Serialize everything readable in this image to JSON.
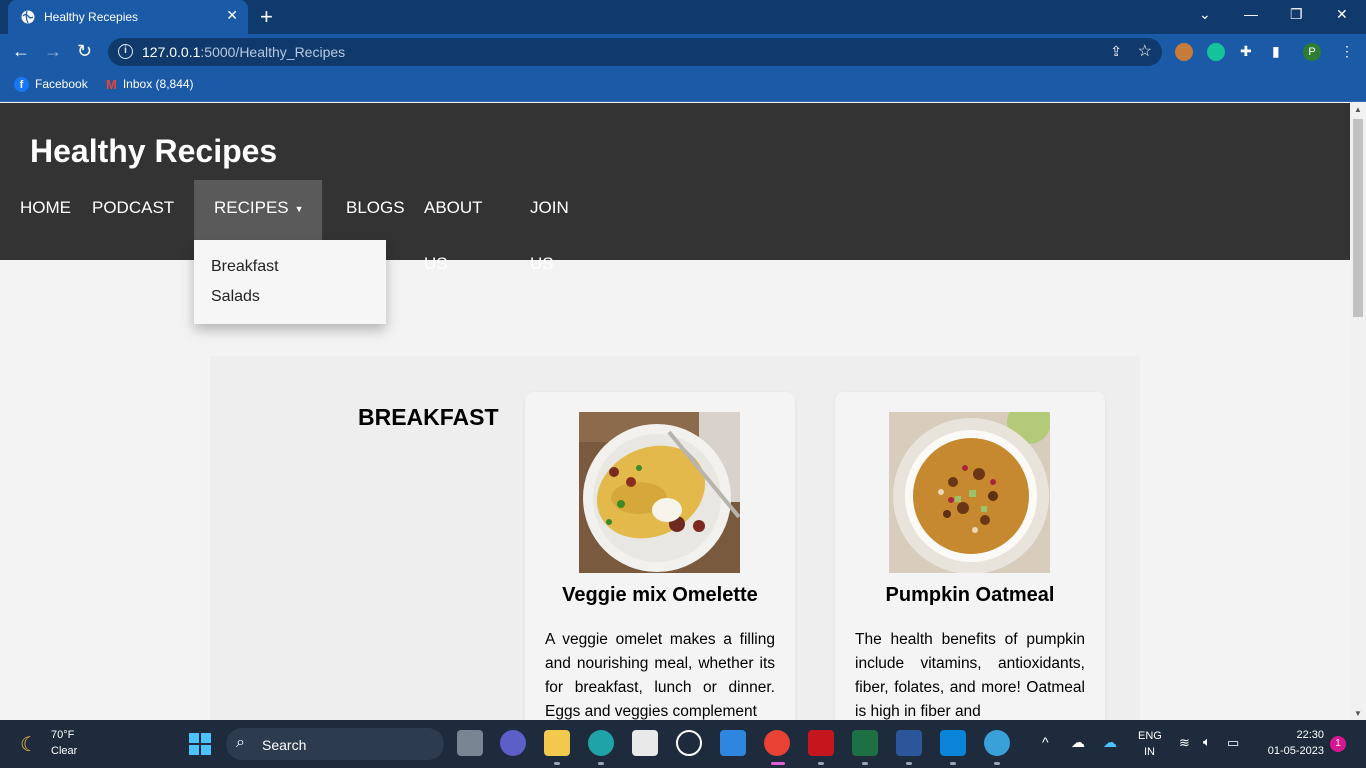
{
  "browser": {
    "tab_title": "Healthy Recepies",
    "url_host": "127.0.0.1",
    "url_path": ":5000/Healthy_Recipes",
    "profile_initial": "P",
    "bookmarks": [
      {
        "label": "Facebook",
        "icon": "facebook-icon"
      },
      {
        "label": "Inbox (8,844)",
        "icon": "gmail-icon"
      }
    ]
  },
  "site": {
    "title": "Healthy Recipes",
    "nav": [
      {
        "label": "HOME"
      },
      {
        "label": "PODCAST"
      },
      {
        "label": "RECIPES"
      },
      {
        "label": "BLOGS"
      },
      {
        "label": "ABOUT US"
      },
      {
        "label": "JOIN US"
      }
    ],
    "active_nav": "RECIPES",
    "dropdown": [
      {
        "label": "Breakfast"
      },
      {
        "label": "Salads"
      }
    ]
  },
  "section": {
    "title": "BREAKFAST",
    "cards": [
      {
        "title": "Veggie mix Omelette",
        "image": "omelette-image",
        "description": "A veggie omelet makes a filling and nourishing meal, whether its for breakfast, lunch or dinner. Eggs and veggies complement"
      },
      {
        "title": "Pumpkin Oatmeal",
        "image": "oatmeal-image",
        "description": "The health benefits of pumpkin include vitamins, antioxidants, fiber, folates, and more! Oatmeal is high in fiber and"
      }
    ]
  },
  "taskbar": {
    "weather_temp": "70°F",
    "weather_cond": "Clear",
    "search_label": "Search",
    "lang_line1": "ENG",
    "lang_line2": "IN",
    "time": "22:30",
    "date": "01-05-2023",
    "notifications": "1"
  },
  "colors": {
    "header_bg": "#333333",
    "active_nav_bg": "#5a5a5a",
    "browser_blue": "#1a5aa6",
    "taskbar_bg": "#1d2b3c"
  }
}
